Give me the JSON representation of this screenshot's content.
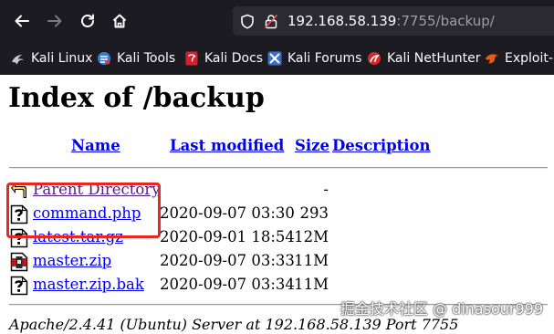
{
  "browser": {
    "url_host": "192.168.58.139",
    "url_rest": ":7755/backup/",
    "bookmarks": [
      {
        "label": "Kali Linux",
        "icon": "kali-dragon-icon"
      },
      {
        "label": "Kali Tools",
        "icon": "kali-tools-icon"
      },
      {
        "label": "Kali Docs",
        "icon": "kali-docs-icon"
      },
      {
        "label": "Kali Forums",
        "icon": "kali-forums-icon"
      },
      {
        "label": "Kali NetHunter",
        "icon": "kali-nethunter-icon"
      },
      {
        "label": "Exploit-D",
        "icon": "exploit-db-icon"
      }
    ]
  },
  "page": {
    "title": "Index of /backup",
    "headers": {
      "name": "Name",
      "last_modified": "Last modified",
      "size": "Size",
      "description": "Description"
    },
    "entries": [
      {
        "name": "Parent Directory",
        "date": "",
        "size": "-",
        "icon": "back-arrow-icon"
      },
      {
        "name": "command.php",
        "date": "2020-09-07 03:30",
        "size": "293",
        "icon": "unknown-file-icon"
      },
      {
        "name": "latest.tar.gz",
        "date": "2020-09-01 18:54",
        "size": "12M",
        "icon": "unknown-file-icon"
      },
      {
        "name": "master.zip",
        "date": "2020-09-07 03:33",
        "size": "11M",
        "icon": "compressed-file-icon"
      },
      {
        "name": "master.zip.bak",
        "date": "2020-09-07 03:34",
        "size": "11M",
        "icon": "unknown-file-icon"
      }
    ],
    "address": "Apache/2.4.41 (Ubuntu) Server at 192.168.58.139 Port 7755"
  },
  "watermark": "掘金技术社区 @ dinasour999",
  "colors": {
    "chrome_bg": "#1c1b22",
    "urlbar_bg": "#2b2a33",
    "link": "#0000ee",
    "visited_link": "#551a8b",
    "highlight": "#e8281e"
  }
}
